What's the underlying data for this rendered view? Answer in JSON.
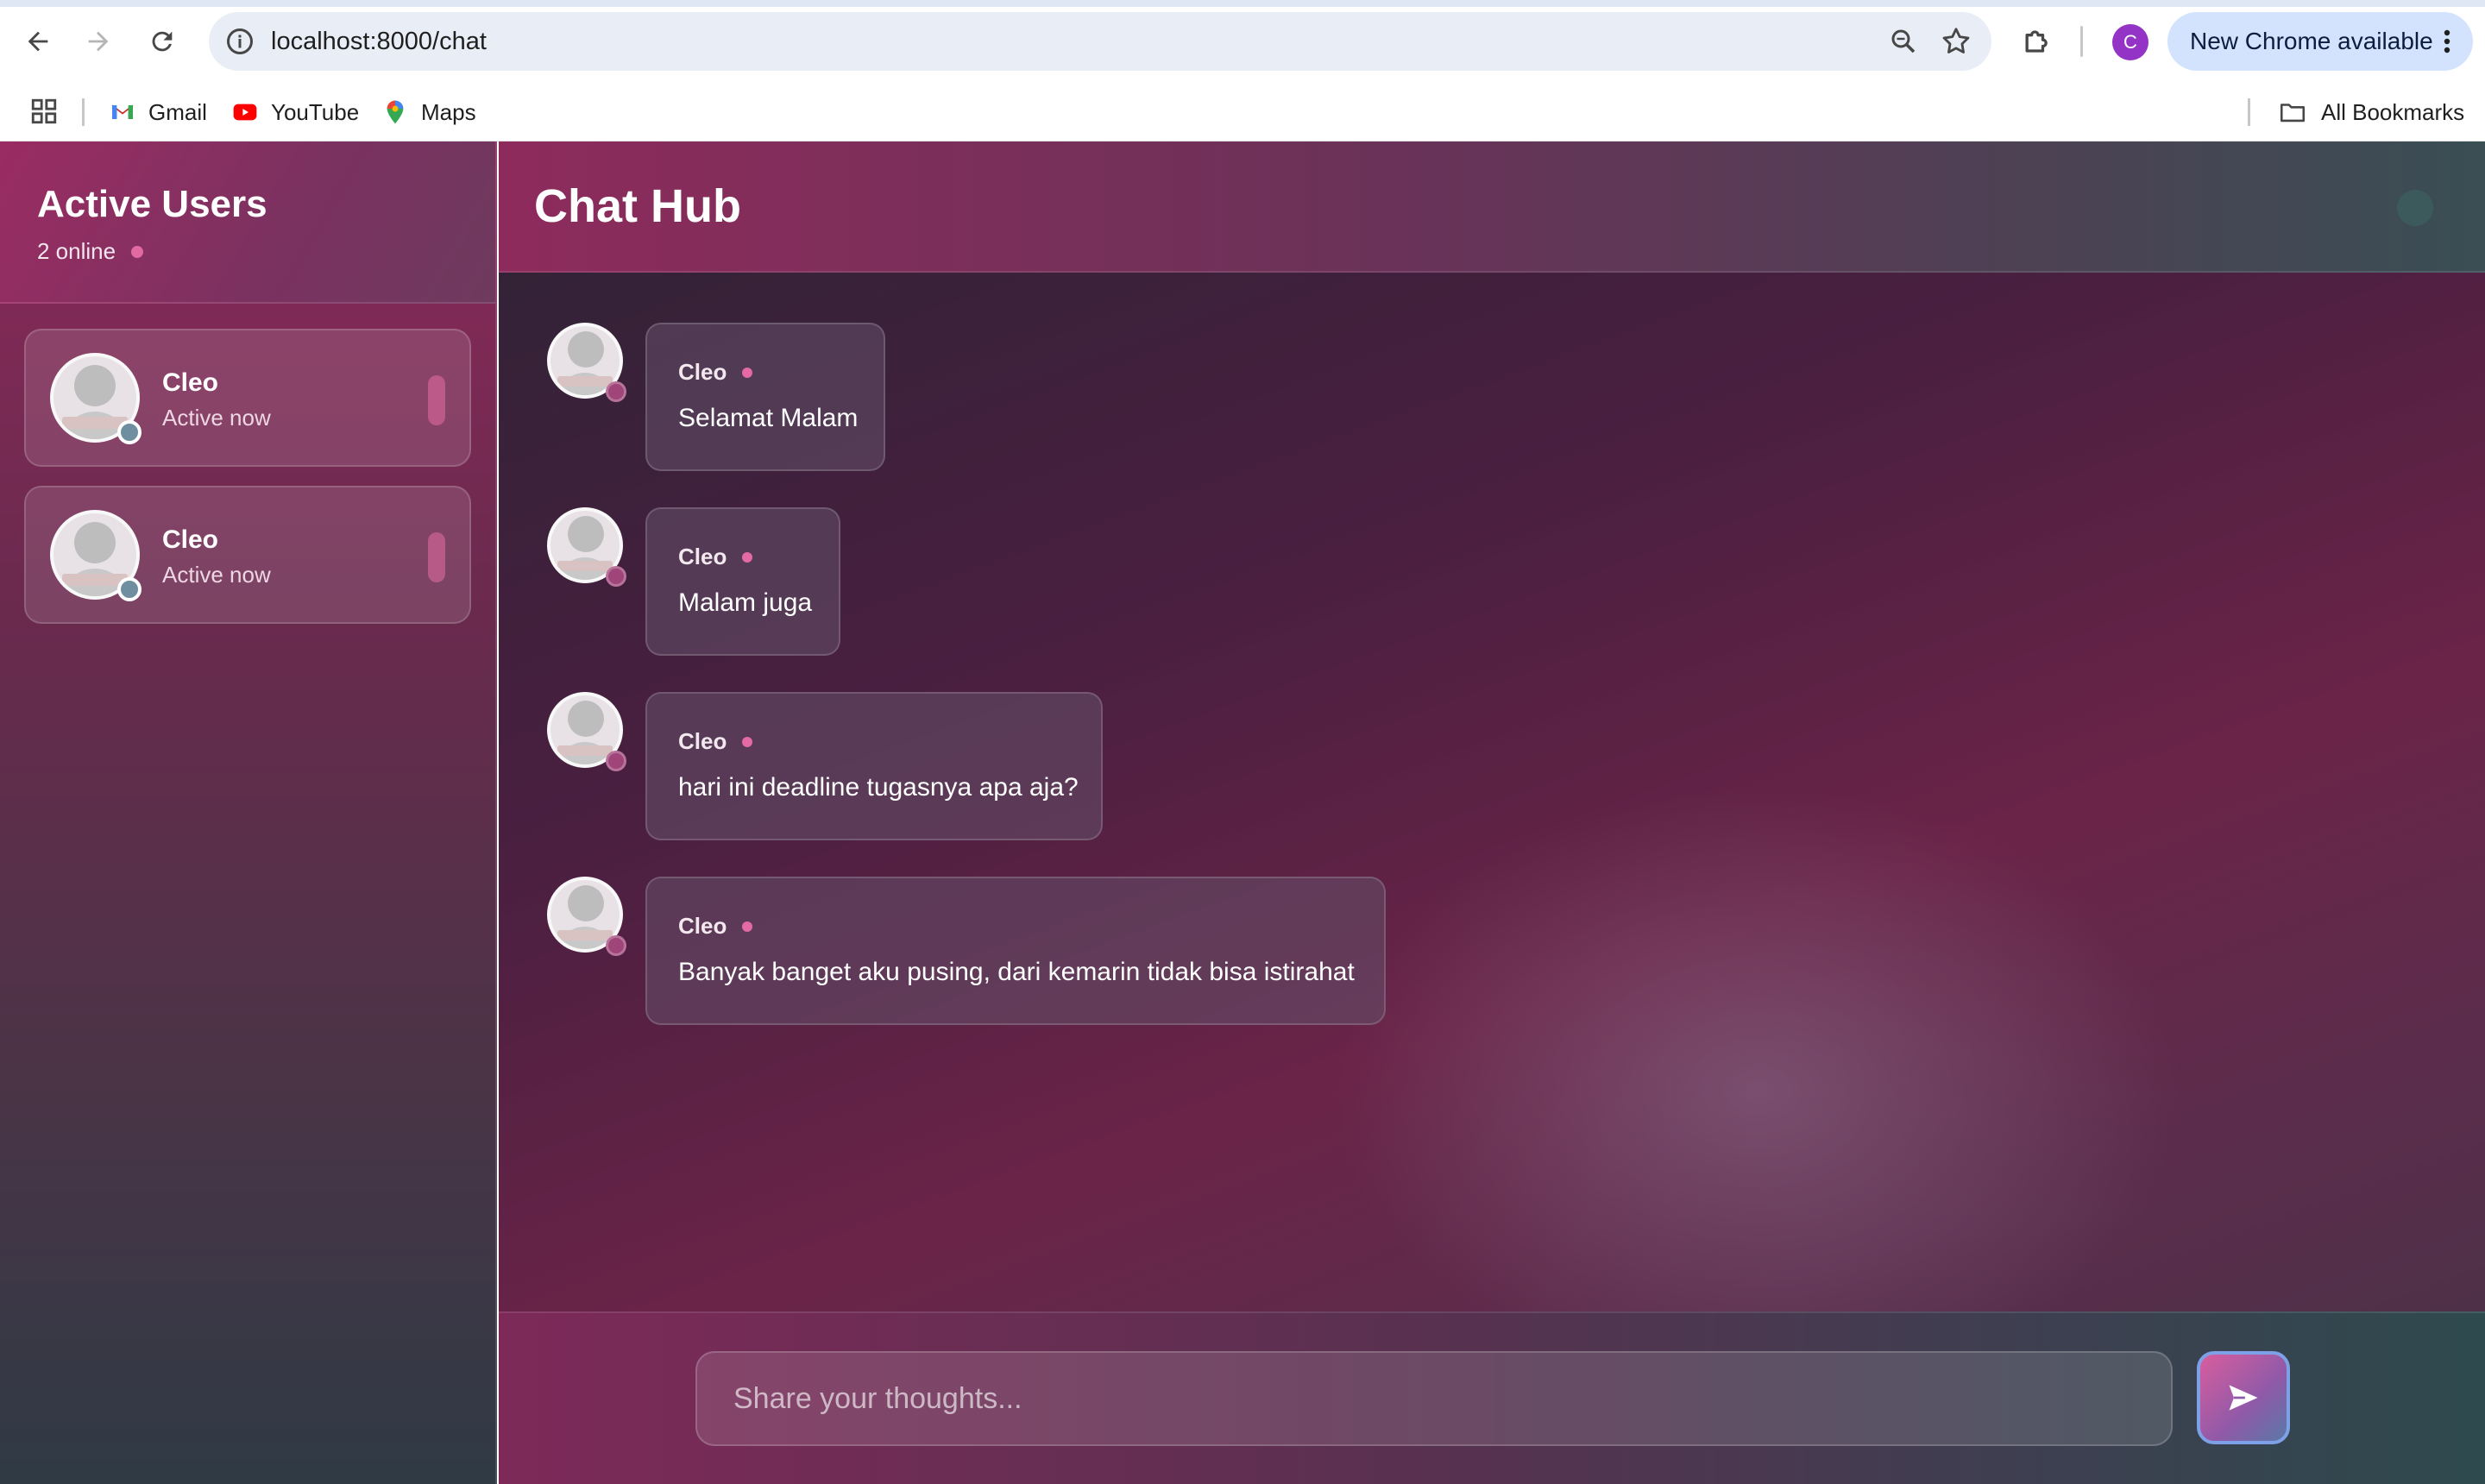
{
  "browser": {
    "url": "localhost:8000/chat",
    "profile_initial": "C",
    "update_label": "New Chrome available",
    "bookmarks": [
      {
        "label": "Gmail",
        "icon": "gmail-icon"
      },
      {
        "label": "YouTube",
        "icon": "youtube-icon"
      },
      {
        "label": "Maps",
        "icon": "maps-icon"
      }
    ],
    "all_bookmarks_label": "All Bookmarks"
  },
  "sidebar": {
    "title": "Active Users",
    "online_count": "2 online",
    "users": [
      {
        "name": "Cleo",
        "status": "Active now"
      },
      {
        "name": "Cleo",
        "status": "Active now"
      }
    ]
  },
  "chat": {
    "title": "Chat Hub",
    "messages": [
      {
        "sender": "Cleo",
        "text": "Selamat Malam"
      },
      {
        "sender": "Cleo",
        "text": "Malam juga"
      },
      {
        "sender": "Cleo",
        "text": "hari ini deadline tugasnya apa aja?"
      },
      {
        "sender": "Cleo",
        "text": "Banyak banget aku pusing, dari kemarin tidak bisa istirahat"
      }
    ],
    "input_placeholder": "Share your thoughts...",
    "input_value": ""
  },
  "colors": {
    "accent": "#e36aa3",
    "sidebar_top": "#8a2a5a",
    "chrome_update_pill": "#d3e3fd",
    "profile": "#9334c6"
  }
}
